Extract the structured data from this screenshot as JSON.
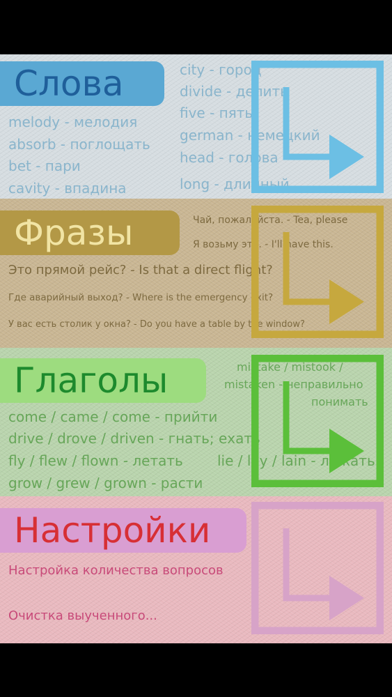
{
  "words": {
    "title": "Слова",
    "left_items": [
      "melody - мелодия",
      "absorb - поглощать",
      "bet - пари",
      "cavity - впадина"
    ],
    "right_items": [
      "city - город",
      "divide - делить",
      "five - пять",
      "german - немецкий",
      "head - голова",
      "long - длинный"
    ]
  },
  "phrases": {
    "title": "Фразы",
    "items": [
      "Чай, пожалуйста. - Tea, please",
      "Я возьму это. - I'll have this.",
      "Это прямой рейс? - Is that a direct flight?",
      "Где аварийный выход? - Where is the emergency exit?",
      "У вас есть столик у окна? - Do you have a table by the window?"
    ]
  },
  "verbs": {
    "title": "Глаголы",
    "left_items": [
      "come / came / come - прийти",
      "drive / drove / driven - гнать; ехать",
      "fly / flew / flown - летать",
      "grow / grew / grown - расти"
    ],
    "right_items": [
      "mistake / mistook /",
      "mistaken - неправильно",
      "понимать",
      "lie / lay / lain - лежать"
    ]
  },
  "settings": {
    "title": "Настройки",
    "items": [
      "Настройка количества вопросов",
      "Очистка выученного..."
    ]
  },
  "colors": {
    "words_arrow": "#6cbfe4",
    "phrases_arrow": "#c6a83e",
    "verbs_arrow": "#5bbf3a",
    "settings_arrow": "#d7a3c8"
  },
  "icons": [
    "arrow-icon"
  ]
}
